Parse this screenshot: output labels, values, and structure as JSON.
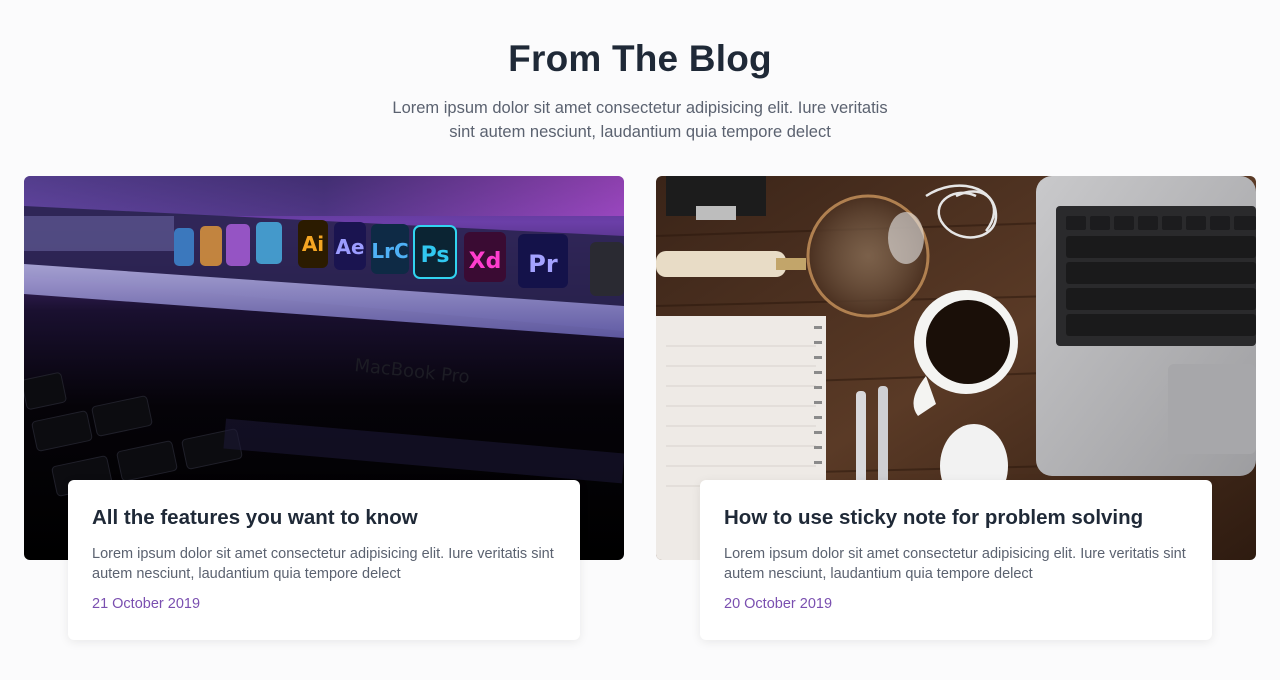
{
  "header": {
    "title": "From The Blog",
    "subtitle": "Lorem ipsum dolor sit amet consectetur adipisicing elit. Iure veritatis sint autem nesciunt, laudantium quia tempore delect"
  },
  "posts": [
    {
      "title": "All the features you want to know",
      "excerpt": "Lorem ipsum dolor sit amet consectetur adipisicing elit. Iure veritatis sint autem nesciunt, laudantium quia tempore delect",
      "date": "21 October 2019",
      "image": {
        "dock_apps": [
          "Ai",
          "Ae",
          "LrC",
          "Ps",
          "Xd",
          "Pr"
        ],
        "laptop_text": "MacBook Pro"
      }
    },
    {
      "title": "How to use sticky note for problem solving",
      "excerpt": "Lorem ipsum dolor sit amet consectetur adipisicing elit. Iure veritatis sint autem nesciunt, laudantium quia tempore delect",
      "date": "20 October 2019"
    }
  ],
  "colors": {
    "accent_date": "#7a4fb0",
    "heading": "#1f2937",
    "body_text": "#5b6270"
  }
}
